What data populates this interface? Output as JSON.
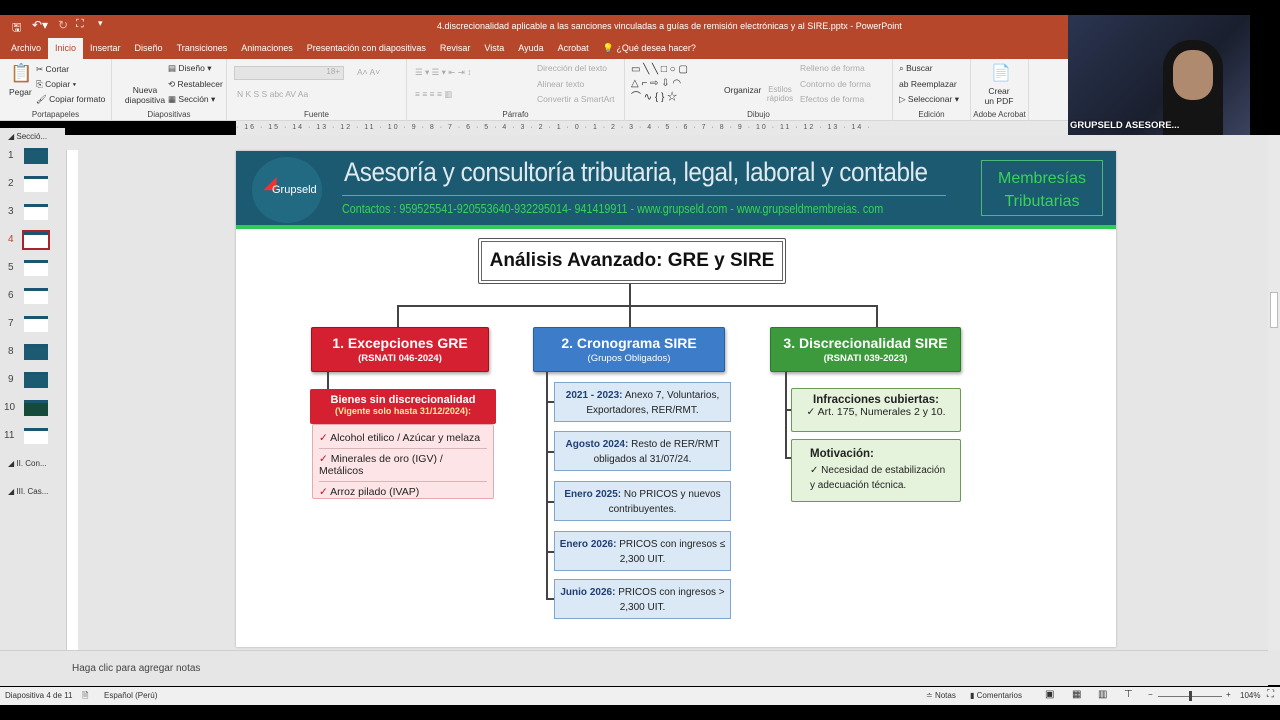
{
  "window": {
    "title": "4.discrecionalidad aplicable a las sanciones vinculadas a guías de remisión electrónicas y al SIRE.pptx  -  PowerPoint"
  },
  "tabs": [
    "Archivo",
    "Inicio",
    "Insertar",
    "Diseño",
    "Transiciones",
    "Animaciones",
    "Presentación con diapositivas",
    "Revisar",
    "Vista",
    "Ayuda",
    "Acrobat"
  ],
  "tell_me": "¿Qué desea hacer?",
  "ribbon": {
    "portapapeles": {
      "label": "Portapapeles",
      "pegar": "Pegar",
      "cortar": "Cortar",
      "copiar": "Copiar",
      "copiar_formato": "Copiar formato"
    },
    "diapositivas": {
      "label": "Diapositivas",
      "nueva": "Nueva diapositiva",
      "diseno": "Diseño",
      "restablecer": "Restablecer",
      "seccion": "Sección"
    },
    "fuente": {
      "label": "Fuente",
      "size": "18+",
      "styles": "N  K  S  S  abc  AV  Aa"
    },
    "parrafo": {
      "label": "Párrafo",
      "direccion": "Dirección del texto",
      "alinear": "Alinear texto",
      "smartart": "Convertir a SmartArt"
    },
    "dibujo": {
      "label": "Dibujo",
      "organizar": "Organizar",
      "estilos": "Estilos rápidos",
      "relleno": "Relleno de forma",
      "contorno": "Contorno de forma",
      "efectos": "Efectos de forma"
    },
    "edicion": {
      "label": "Edición",
      "buscar": "Buscar",
      "reemplazar": "Reemplazar",
      "seleccionar": "Seleccionar"
    },
    "acrobat": {
      "label": "Adobe Acrobat",
      "crear": "Crear un PDF"
    }
  },
  "ruler": "· 16 · 15 · 14 · 13 · 12 · 11 · 10 · 9 · 8 · 7 · 6 · 5 · 4 · 3 · 2 · 1 · 0 · 1 · 2 · 3 · 4 · 5 · 6 · 7 · 8 · 9 · 10 · 11 · 12 · 13 · 14 ·",
  "video": {
    "name": "GRUPSELD ASESORE..."
  },
  "thumbnails": {
    "section1": "Secció...",
    "slides": [
      "1",
      "2",
      "3",
      "4",
      "5",
      "6",
      "7",
      "8",
      "9",
      "10",
      "11"
    ],
    "section2": "II. Con...",
    "section3": "III. Cas..."
  },
  "slide": {
    "logo": "Grupseld",
    "banner_title": "Asesoría y consultoría tributaria, legal, laboral  y contable",
    "contacts": "Contactos : 959525541-920553640-932295014- 941419911 - www.grupseld.com - www.grupseldmembreias. com",
    "membership": "Membresías Tributarias",
    "main_title": "Análisis Avanzado: GRE y SIRE",
    "col1": {
      "title": "1. Excepciones GRE",
      "subtitle": "(RSNATI 046-2024)",
      "sub_header": "Bienes sin discrecionalidad",
      "sub_note": "(Vigente solo hasta 31/12/2024):",
      "items": [
        "Alcohol etilico / Azúcar y melaza",
        "Minerales de oro (IGV) / Metálicos",
        "Arroz pilado (IVAP)"
      ]
    },
    "col2": {
      "title": "2. Cronograma SIRE",
      "subtitle": "(Grupos Obligados)",
      "items": [
        {
          "date": "2021 - 2023:",
          "text": "Anexo 7, Voluntarios, Exportadores, RER/RMT."
        },
        {
          "date": "Agosto 2024:",
          "text": "Resto de RER/RMT obligados al 31/07/24."
        },
        {
          "date": "Enero 2025:",
          "text": "No PRICOS y nuevos contribuyentes."
        },
        {
          "date": "Enero 2026:",
          "text": "PRICOS con ingresos ≤ 2,300 UIT."
        },
        {
          "date": "Junio 2026:",
          "text": "PRICOS con ingresos > 2,300 UIT."
        }
      ]
    },
    "col3": {
      "title": "3. Discrecionalidad SIRE",
      "subtitle": "(RSNATI 039-2023)",
      "box1_title": "Infracciones cubiertas:",
      "box1_item": "Art. 175, Numerales 2 y 10.",
      "box2_title": "Motivación:",
      "box2_item": "Necesidad de estabilización y adecuación técnica."
    },
    "check": "✓"
  },
  "notes_placeholder": "Haga clic para agregar notas",
  "status": {
    "slide": "Diapositiva 4 de 11",
    "language": "Español (Perú)",
    "notes": "Notas",
    "comments": "Comentarios",
    "zoom": "104%"
  },
  "colors": {
    "ribbon_brand": "#b7472a",
    "band": "#1c5a72",
    "red": "#d42030",
    "blue": "#3d7cc9",
    "green": "#3c9a3c"
  }
}
